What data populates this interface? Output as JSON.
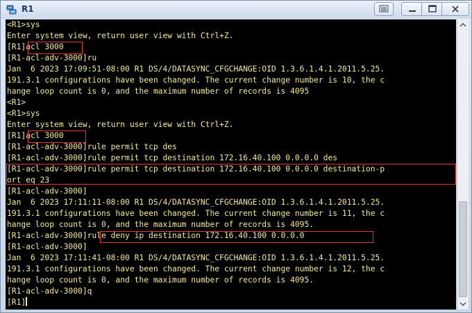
{
  "window": {
    "title": "R1",
    "icon": "network-device-icon"
  },
  "terminal": {
    "lines": [
      "<R1>sys",
      "Enter system view, return user view with Ctrl+Z.",
      "[R1]acl 3000",
      "[R1-acl-adv-3000]ru",
      "Jan  6 2023 17:09:51-08:00 R1 DS/4/DATASYNC_CFGCHANGE:OID 1.3.6.1.4.1.2011.5.25.",
      "191.3.1 configurations have been changed. The current change number is 10, the c",
      "hange loop count is 0, and the maximum number of records is 4095",
      "<R1>",
      "<R1>sys",
      "Enter system view, return user view with Ctrl+Z.",
      "[R1]acl 3000",
      "[R1-acl-adv-3000]rule permit tcp des",
      "[R1-acl-adv-3000]rule permit tcp destination 172.16.40.100 0.0.0.0 des",
      "[R1-acl-adv-3000]rule permit tcp destination 172.16.40.100 0.0.0.0 destination-p",
      "ort eq 23",
      "[R1-acl-adv-3000]",
      "Jan  6 2023 17:11:11-08:00 R1 DS/4/DATASYNC_CFGCHANGE:OID 1.3.6.1.4.1.2011.5.25.",
      "191.3.1 configurations have been changed. The current change number is 11, the c",
      "hange loop count is 0, and the maximum number of records is 4095.",
      "[R1-acl-adv-3000]rule deny ip destination 172.16.40.100 0.0.0.0",
      "[R1-acl-adv-3000]",
      "Jan  6 2023 17:11:41-08:00 R1 DS/4/DATASYNC_CFGCHANGE:OID 1.3.6.1.4.1.2011.5.25.",
      "191.3.1 configurations have been changed. The current change number is 12, the c",
      "hange loop count is 0, and the maximum number of records is 4095.",
      "[R1-acl-adv-3000]q",
      "[R1]"
    ],
    "text_color": "#f2ea96",
    "background_color": "#000000",
    "highlight_color": "#e23a3a"
  }
}
